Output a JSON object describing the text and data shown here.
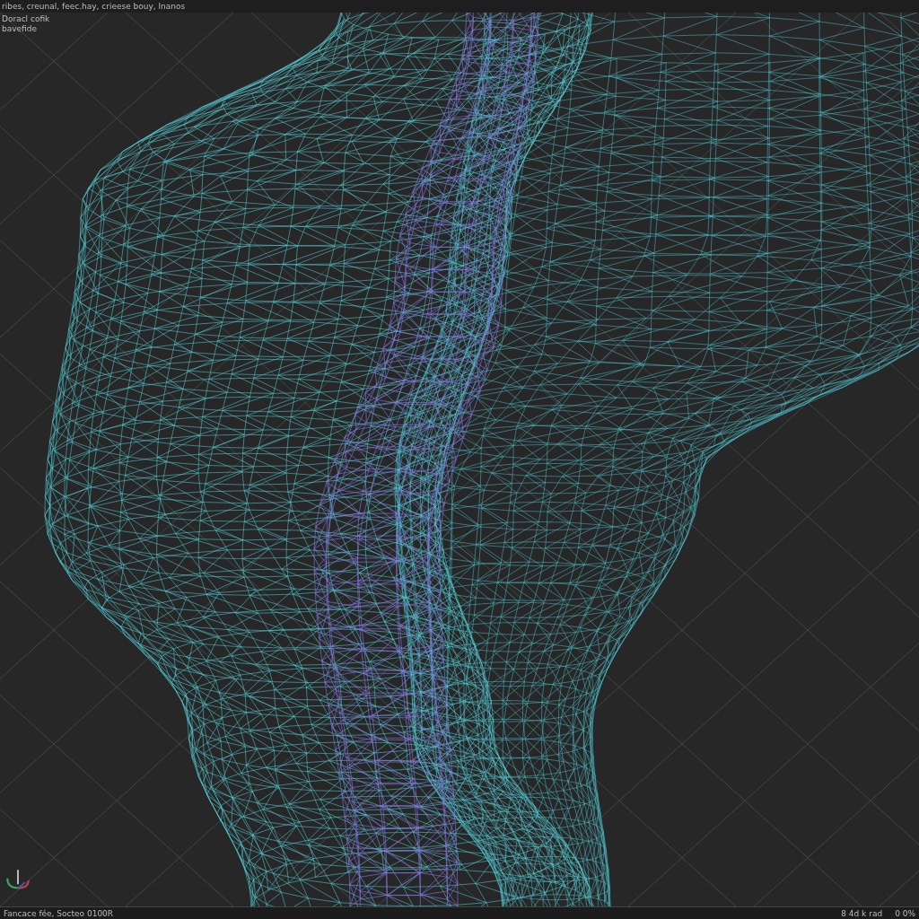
{
  "header": {
    "menu_text": "ribes, creunal, feec.hay, crieese bouy, lnanos"
  },
  "viewport": {
    "labels": [
      "Doracl cofik",
      "bavefide"
    ]
  },
  "status_bar": {
    "left_text": "Fancace fée, Socteo 0100R",
    "right_items": [
      "8 4d k rad",
      "0 0%"
    ]
  }
}
